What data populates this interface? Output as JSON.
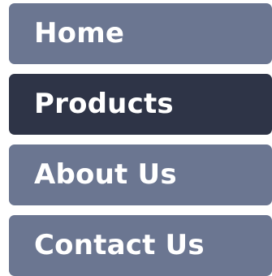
{
  "nav": {
    "items": [
      {
        "label": "Home",
        "active": false
      },
      {
        "label": "Products",
        "active": true
      },
      {
        "label": "About Us",
        "active": false
      },
      {
        "label": "Contact Us",
        "active": false
      }
    ],
    "colors": {
      "inactive_bg": "#6b7691",
      "active_bg": "#2e3447",
      "text": "#ffffff"
    }
  }
}
